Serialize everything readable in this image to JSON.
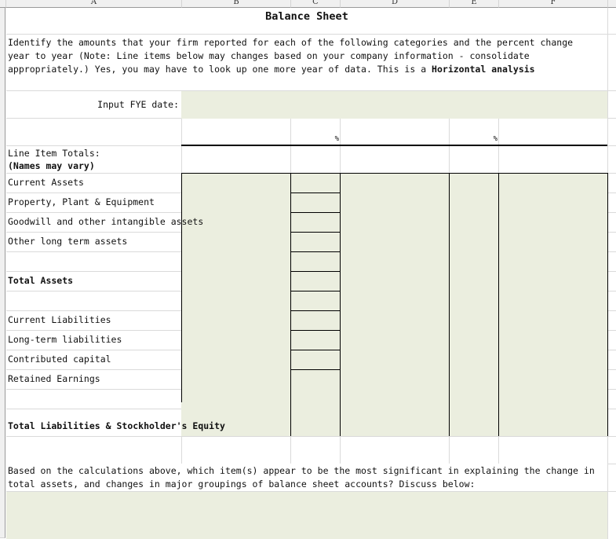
{
  "spreadsheet": {
    "column_headers": [
      "A",
      "B",
      "C",
      "D",
      "E",
      "F"
    ],
    "row_header_fragments": [
      "",
      "",
      "",
      "",
      "",
      "",
      ""
    ],
    "title": "Balance Sheet",
    "instructions": {
      "line1": "Identify the amounts that your firm reported for each of the following categories and the percent change",
      "line2": "year to year (Note: Line items below may changes based on your company information - consolidate",
      "line3_plain": "appropriately.) Yes, you may have to look up one more year of data. This is a ",
      "line3_bold": "Horizontal analysis"
    },
    "fye_label": "Input FYE date:",
    "fye_value": "",
    "percent_headers": [
      "%",
      "%"
    ],
    "line_items_header": "Line Item Totals:",
    "line_items_subheader": "(Names may vary)",
    "line_items": [
      {
        "label": "Current Assets",
        "bold": false
      },
      {
        "label": "Property, Plant & Equipment",
        "bold": false
      },
      {
        "label": "Goodwill and other intangible assets",
        "bold": false
      },
      {
        "label": "Other long term assets",
        "bold": false
      },
      {
        "label": "",
        "bold": false
      },
      {
        "label": "Total Assets",
        "bold": true
      },
      {
        "label": "",
        "bold": false
      },
      {
        "label": "Current Liabilities",
        "bold": false
      },
      {
        "label": "Long-term liabilities",
        "bold": false
      },
      {
        "label": "Contributed capital",
        "bold": false
      },
      {
        "label": "Retained Earnings",
        "bold": false
      },
      {
        "label": "",
        "bold": false
      },
      {
        "label": "Total Liabilities & Stockholder's Equity",
        "bold": true
      }
    ],
    "discussion_prompt_line1": "Based on the calculations above, which item(s) appear to be the most significant in explaining the change in",
    "discussion_prompt_line2": "total assets, and changes in major groupings of balance sheet accounts?  Discuss below:",
    "discussion_answer": "",
    "input_fill_color": "#ebeedf"
  }
}
